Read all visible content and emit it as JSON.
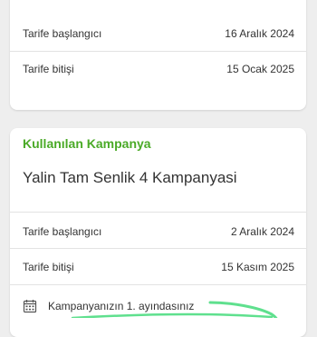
{
  "tariff_card": {
    "start_label": "Tarife başlangıcı",
    "start_value": "16 Aralık 2024",
    "end_label": "Tarife bitişi",
    "end_value": "15 Ocak 2025"
  },
  "campaign_card": {
    "heading": "Kullanılan Kampanya",
    "name": "Yalin Tam Senlik 4 Kampanyasi",
    "start_label": "Tarife başlangıcı",
    "start_value": "2 Aralık 2024",
    "end_label": "Tarife bitişi",
    "end_value": "15 Kasım 2025",
    "info_text": "Kampanyanızın 1. ayındasınız",
    "info_icon": "calendar-icon"
  },
  "colors": {
    "accent_green": "#4aaa27",
    "highlight_green": "#5fe08e",
    "text": "#333333",
    "background": "#eeeeee"
  }
}
